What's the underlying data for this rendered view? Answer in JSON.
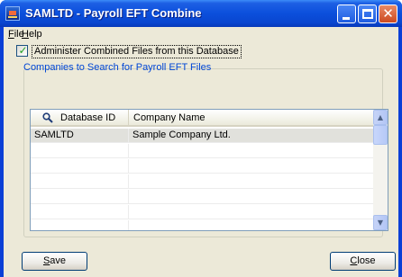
{
  "window": {
    "title": "SAMLTD - Payroll EFT Combine",
    "controls": [
      "minimize",
      "maximize",
      "close"
    ]
  },
  "menu": {
    "items": [
      {
        "key": "F",
        "rest": "ile"
      },
      {
        "key": "H",
        "rest": "elp"
      }
    ]
  },
  "options": {
    "administer_label": "Administer Combined Files from this Database",
    "administer_checked": true
  },
  "group": {
    "label": "Companies to Search for Payroll EFT Files"
  },
  "grid": {
    "columns": [
      "Database ID",
      "Company Name"
    ],
    "rows": [
      {
        "database_id": "SAMLTD",
        "company_name": "Sample Company Ltd."
      },
      {
        "database_id": "",
        "company_name": ""
      },
      {
        "database_id": "",
        "company_name": ""
      },
      {
        "database_id": "",
        "company_name": ""
      },
      {
        "database_id": "",
        "company_name": ""
      },
      {
        "database_id": "",
        "company_name": ""
      },
      {
        "database_id": "",
        "company_name": ""
      }
    ],
    "selected_row": 0
  },
  "buttons": {
    "save": {
      "key": "S",
      "rest": "ave"
    },
    "close": {
      "key": "C",
      "rest": "lose"
    }
  },
  "colors": {
    "titlebar": "#0b4fdc",
    "group_label": "#0046d5",
    "dialog_bg": "#ece9d8"
  },
  "icons": {
    "app": "payroll-app-icon",
    "search": "search-icon"
  }
}
